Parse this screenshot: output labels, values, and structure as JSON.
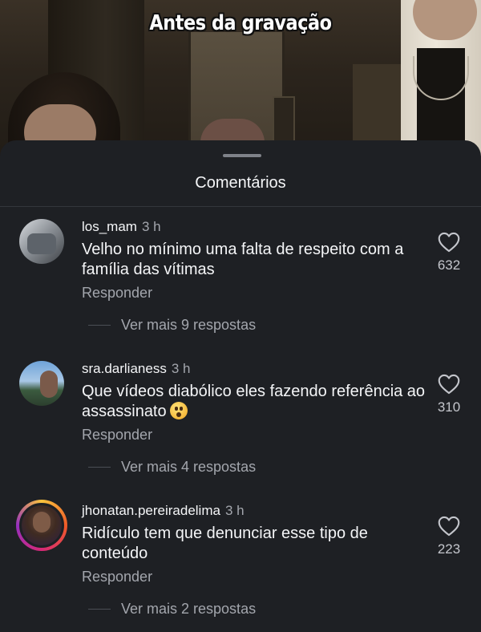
{
  "video": {
    "caption": "Antes da gravação"
  },
  "sheet": {
    "title": "Comentários"
  },
  "comments": [
    {
      "username": "los_mam",
      "time": "3 h",
      "text": "Velho no mínimo uma falta de respeito com a família das vítimas",
      "reply_label": "Responder",
      "likes": "632",
      "more_replies": "Ver mais 9 respostas"
    },
    {
      "username": "sra.darlianess",
      "time": "3 h",
      "text": "Que vídeos diabólico eles fazendo referência ao assassinato",
      "emoji": "hushed-face-emoji",
      "reply_label": "Responder",
      "likes": "310",
      "more_replies": "Ver mais 4 respostas"
    },
    {
      "username": "jhonatan.pereiradelima",
      "time": "3 h",
      "text": "Ridículo tem que denunciar esse tipo de conteúdo",
      "reply_label": "Responder",
      "likes": "223",
      "more_replies": "Ver mais 2 respostas"
    }
  ],
  "icons": {
    "like": "heart-outline-icon"
  },
  "colors": {
    "sheet_bg": "#1e2024",
    "primary_text": "#f4f5f7",
    "secondary_text": "#a3a6ad",
    "story_ring": [
      "#f9c33c",
      "#f05a28",
      "#d62976",
      "#962fbf"
    ]
  }
}
